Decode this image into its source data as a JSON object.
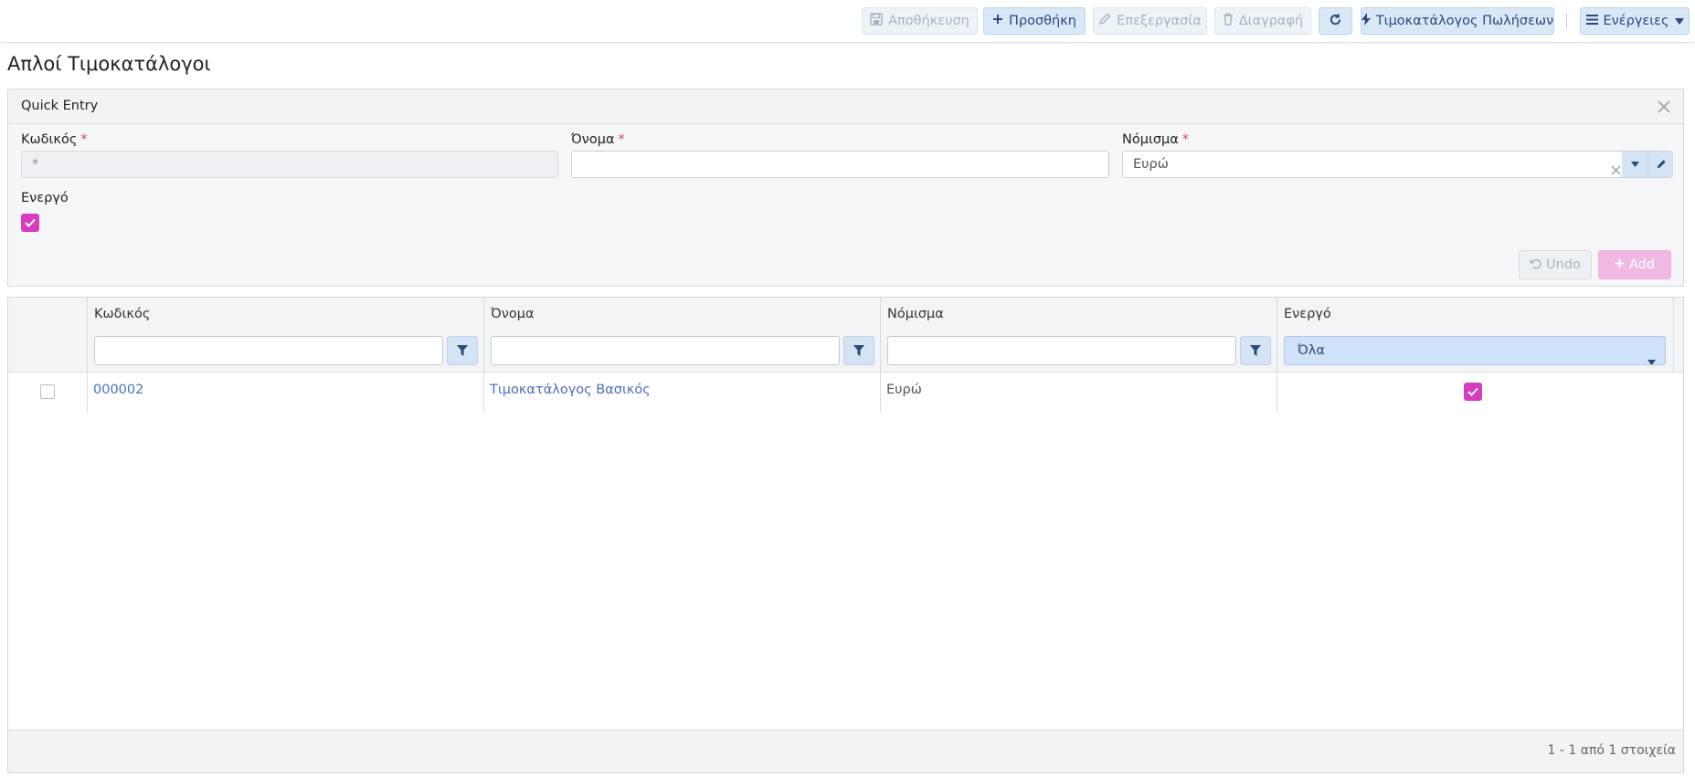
{
  "toolbar": {
    "save_label": "Αποθήκευση",
    "add_label": "Προσθήκη",
    "edit_label": "Επεξεργασία",
    "delete_label": "Διαγραφή",
    "pricelist_label": "Τιμοκατάλογος Πωλήσεων",
    "actions_label": "Ενέργειες"
  },
  "page": {
    "title": "Απλοί Τιμοκατάλογοι"
  },
  "quick_entry": {
    "title": "Quick Entry",
    "code_label": "Κωδικός",
    "code_value": "*",
    "name_label": "Όνομα",
    "name_value": "",
    "currency_label": "Νόμισμα",
    "currency_value": "Ευρώ",
    "active_label": "Ενεργό",
    "active_checked": true,
    "undo_label": "Undo",
    "add_label": "Add",
    "required_mark": "*"
  },
  "grid": {
    "columns": [
      "Κωδικός",
      "Όνομα",
      "Νόμισμα",
      "Ενεργό"
    ],
    "active_filter": "Όλα",
    "rows": [
      {
        "code": "000002",
        "name": "Τιμοκατάλογος Βασικός",
        "currency": "Ευρώ",
        "active": true
      }
    ],
    "pager_text": "1 - 1 από 1 στοιχεία"
  },
  "colors": {
    "accent": "#d63cc0",
    "primary_button": "#d9e8f7",
    "link": "#4a6fbf",
    "required": "#e0453a"
  }
}
